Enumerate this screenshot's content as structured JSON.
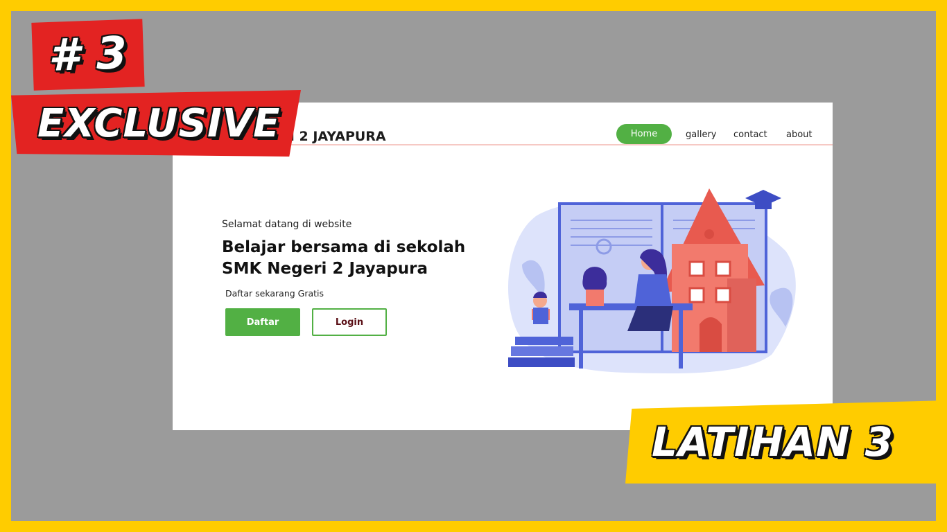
{
  "thumbnail": {
    "episode_badge": "# 3",
    "exclusive_badge": "EXCLUSIVE",
    "title_badge": "LATIHAN 3"
  },
  "site": {
    "brand_visible": "N 2 JAYAPURA",
    "nav": {
      "home": "Home",
      "gallery": "gallery",
      "contact": "contact",
      "about": "about"
    },
    "hero": {
      "welcome": "Selamat datang di website",
      "headline_line1": "Belajar bersama di sekolah",
      "headline_line2": "SMK Negeri 2 Jayapura",
      "subtext": "Daftar sekarang Gratis",
      "daftar_button": "Daftar",
      "login_button": "Login"
    }
  },
  "colors": {
    "frame_border": "#ffcc00",
    "badge_red": "#e32322",
    "accent_green": "#52b044",
    "illustration_blue": "#4f63d8",
    "house_coral": "#f27a6d"
  }
}
